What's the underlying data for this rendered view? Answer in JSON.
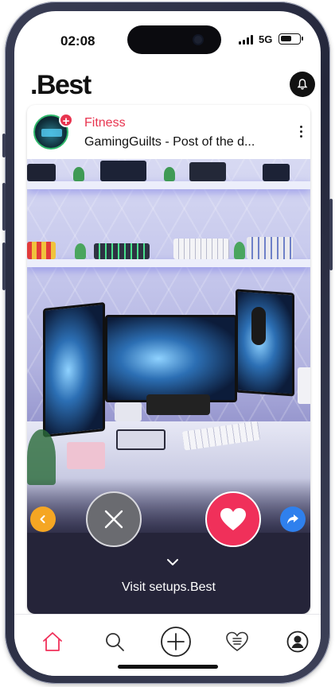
{
  "status_bar": {
    "time": "02:08",
    "network": "5G",
    "battery_level": 0.6
  },
  "app": {
    "logo": ".Best",
    "notifications_icon": "bell-icon"
  },
  "post": {
    "category": "Fitness",
    "title": "GamingGuilts - Post of the d...",
    "avatar_badge": "+",
    "image_subject": "gaming-desk-setup-photo"
  },
  "actions": {
    "back_icon": "chevron-left-icon",
    "dislike_icon": "close-icon",
    "like_icon": "heart-icon",
    "share_icon": "share-icon",
    "expand_icon": "chevron-down-icon",
    "visit_label": "Visit setups.Best"
  },
  "tabbar": {
    "items": [
      {
        "name": "home",
        "icon": "home-icon",
        "active": true
      },
      {
        "name": "search",
        "icon": "search-icon",
        "active": false
      },
      {
        "name": "create",
        "icon": "plus-circle-icon",
        "active": false
      },
      {
        "name": "favorites",
        "icon": "heart-list-icon",
        "active": false
      },
      {
        "name": "profile",
        "icon": "user-icon",
        "active": false
      }
    ]
  },
  "colors": {
    "accent": "#f0305a",
    "category": "#e8344f",
    "back_button": "#f5a623",
    "share_button": "#2f80ed",
    "panel": "#252439"
  }
}
